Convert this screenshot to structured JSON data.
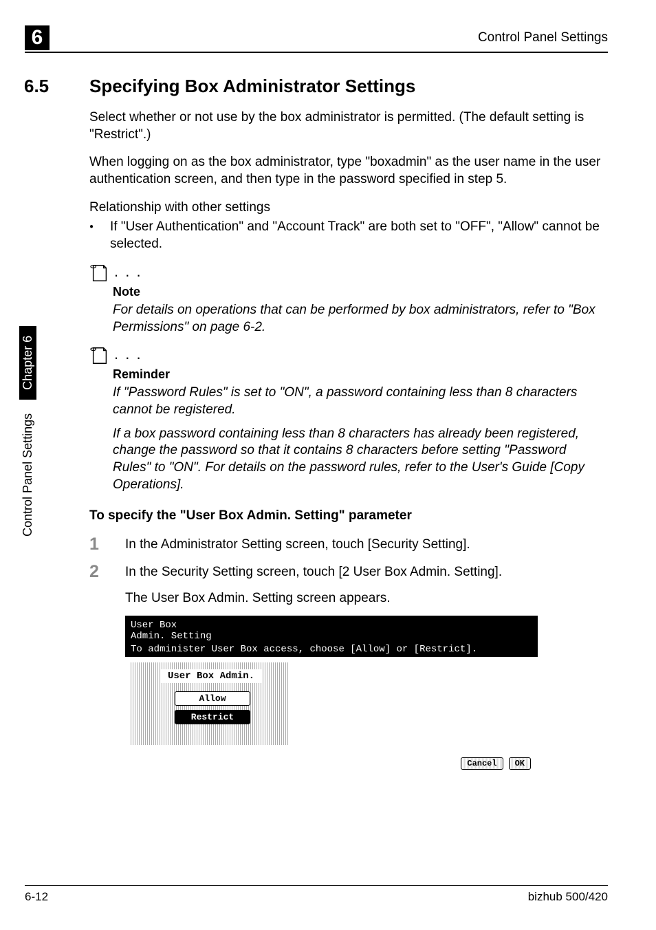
{
  "header": {
    "chapter_number": "6",
    "running_title": "Control Panel Settings"
  },
  "section": {
    "number": "6.5",
    "title": "Specifying Box Administrator Settings"
  },
  "paragraphs": {
    "p1": "Select whether or not use by the box administrator is permitted. (The default setting is \"Restrict\".)",
    "p2": "When logging on as the box administrator, type \"boxadmin\" as the user name in the user authentication screen, and then type in the password specified in step 5.",
    "p3": "Relationship with other settings",
    "bullet1": "If \"User Authentication\" and \"Account Track\" are both set to \"OFF\", \"Allow\" cannot be selected."
  },
  "notes": {
    "note_label": "Note",
    "note_body": "For details on operations that can be performed by box administrators, refer to \"Box Permissions\" on page 6-2.",
    "reminder_label": "Reminder",
    "reminder_body1": "If \"Password Rules\" is set to \"ON\", a password containing less than 8 characters cannot be registered.",
    "reminder_body2": "If a box password containing less than 8 characters has already been registered, change the password so that it contains 8 characters before setting \"Password Rules\" to \"ON\". For details on the password rules, refer to the User's Guide [Copy Operations]."
  },
  "subhead": "To specify the \"User Box Admin. Setting\" parameter",
  "steps": {
    "s1_num": "1",
    "s1_text": "In the Administrator Setting screen, touch [Security Setting].",
    "s2_num": "2",
    "s2_text": "In the Security Setting screen, touch [2 User Box Admin. Setting].",
    "s2_sub": "The User Box Admin. Setting screen appears."
  },
  "screenshot": {
    "title_line1": "User Box",
    "title_line2": "Admin. Setting",
    "instruction": "To administer User Box access, choose [Allow] or [Restrict].",
    "group_label": "User Box Admin.",
    "btn_allow": "Allow",
    "btn_restrict": "Restrict",
    "btn_cancel": "Cancel",
    "btn_ok": "OK"
  },
  "sidebar": {
    "text": "Control Panel Settings",
    "chapter": "Chapter 6"
  },
  "footer": {
    "left": "6-12",
    "right": "bizhub 500/420"
  }
}
